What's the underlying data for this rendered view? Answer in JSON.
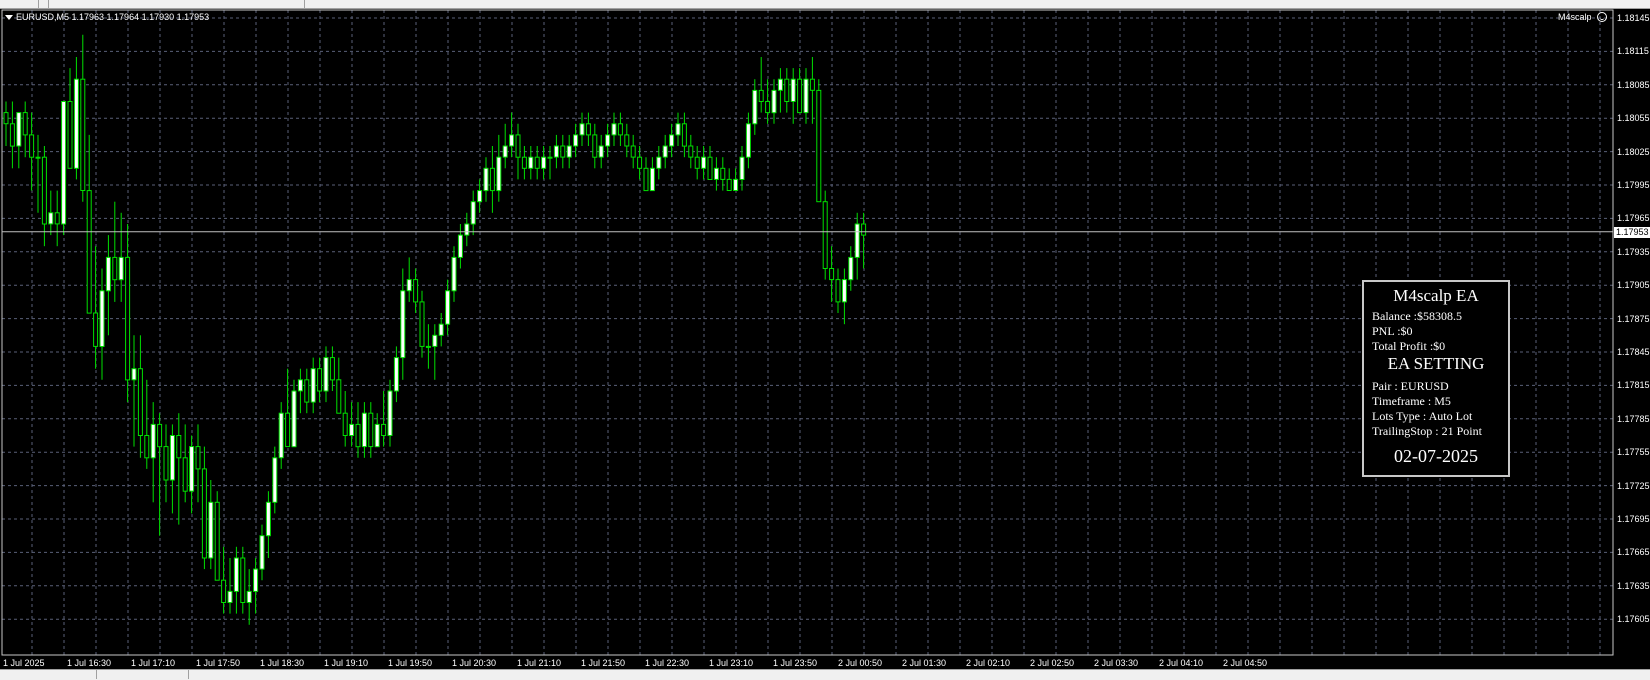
{
  "chart": {
    "symbol_header": "EURUSD,M5  1.17963 1.17964 1.17930 1.17953",
    "ea_name": "M4scalp",
    "current_price": "1.17953",
    "price_axis": [
      "1.18145",
      "1.18115",
      "1.18085",
      "1.18055",
      "1.18025",
      "1.17995",
      "1.17965",
      "1.17935",
      "1.17905",
      "1.17875",
      "1.17845",
      "1.17815",
      "1.17785",
      "1.17755",
      "1.17725",
      "1.17695",
      "1.17665",
      "1.17635",
      "1.17605"
    ],
    "time_axis": [
      "1 Jul 2025",
      "1 Jul 16:30",
      "1 Jul 17:10",
      "1 Jul 17:50",
      "1 Jul 18:30",
      "1 Jul 19:10",
      "1 Jul 19:50",
      "1 Jul 20:30",
      "1 Jul 21:10",
      "1 Jul 21:50",
      "1 Jul 22:30",
      "1 Jul 23:10",
      "1 Jul 23:50",
      "2 Jul 00:50",
      "2 Jul 01:30",
      "2 Jul 02:10",
      "2 Jul 02:50",
      "2 Jul 03:30",
      "2 Jul 04:10",
      "2 Jul 04:50"
    ],
    "colors": {
      "background": "#000000",
      "grid": "#5a6078",
      "bull": "#ffffff",
      "bear": "#000000",
      "wick": "#00e000",
      "text": "#ffffff"
    }
  },
  "ea_panel": {
    "title": "M4scalp EA",
    "balance": "Balance :$58308.5",
    "pnl": "PNL :$0",
    "total_profit": "Total Profit :$0",
    "setting_title": "EA SETTING",
    "pair": "Pair : EURUSD",
    "timeframe": "Timeframe : M5",
    "lots_type": "Lots Type : Auto Lot",
    "trailing_stop": "TrailingStop : 21 Point",
    "date": "02-07-2025"
  },
  "chart_data": {
    "type": "candlestick",
    "ylim": [
      1.1759,
      1.1816
    ],
    "candles": [
      [
        1.1806,
        1.1807,
        1.1803,
        1.1805
      ],
      [
        1.1805,
        1.1807,
        1.1801,
        1.1803
      ],
      [
        1.1803,
        1.1806,
        1.1801,
        1.1806
      ],
      [
        1.1806,
        1.1807,
        1.1802,
        1.1804
      ],
      [
        1.1804,
        1.1806,
        1.1799,
        1.1802
      ],
      [
        1.1802,
        1.1804,
        1.1797,
        1.1802
      ],
      [
        1.1802,
        1.1803,
        1.1794,
        1.1796
      ],
      [
        1.1796,
        1.1799,
        1.1795,
        1.1797
      ],
      [
        1.1797,
        1.1799,
        1.1794,
        1.1796
      ],
      [
        1.1796,
        1.1807,
        1.1795,
        1.1807
      ],
      [
        1.1807,
        1.181,
        1.1804,
        1.1801
      ],
      [
        1.1801,
        1.1811,
        1.18,
        1.1809
      ],
      [
        1.1809,
        1.1813,
        1.1798,
        1.1799
      ],
      [
        1.1799,
        1.1804,
        1.1788,
        1.1788
      ],
      [
        1.1788,
        1.1794,
        1.1783,
        1.1785
      ],
      [
        1.1785,
        1.1792,
        1.1782,
        1.179
      ],
      [
        1.179,
        1.1795,
        1.1786,
        1.1793
      ],
      [
        1.1793,
        1.1798,
        1.1789,
        1.1791
      ],
      [
        1.1791,
        1.1797,
        1.1789,
        1.1793
      ],
      [
        1.1793,
        1.1796,
        1.178,
        1.1782
      ],
      [
        1.1782,
        1.1786,
        1.1776,
        1.1783
      ],
      [
        1.1783,
        1.1786,
        1.1775,
        1.1777
      ],
      [
        1.1777,
        1.1782,
        1.1774,
        1.1775
      ],
      [
        1.1775,
        1.178,
        1.1771,
        1.1778
      ],
      [
        1.1778,
        1.1779,
        1.1768,
        1.1776
      ],
      [
        1.1776,
        1.1778,
        1.1771,
        1.1773
      ],
      [
        1.1773,
        1.1778,
        1.177,
        1.1777
      ],
      [
        1.1777,
        1.1779,
        1.1769,
        1.1775
      ],
      [
        1.1775,
        1.1778,
        1.1771,
        1.1772
      ],
      [
        1.1772,
        1.1777,
        1.177,
        1.1776
      ],
      [
        1.1776,
        1.1778,
        1.1771,
        1.1774
      ],
      [
        1.1774,
        1.1776,
        1.1765,
        1.1766
      ],
      [
        1.1766,
        1.1773,
        1.1765,
        1.1771
      ],
      [
        1.1771,
        1.1772,
        1.1764,
        1.1764
      ],
      [
        1.1764,
        1.1767,
        1.1761,
        1.1762
      ],
      [
        1.1762,
        1.1766,
        1.1761,
        1.1763
      ],
      [
        1.1763,
        1.1767,
        1.1761,
        1.1766
      ],
      [
        1.1766,
        1.1767,
        1.1761,
        1.1762
      ],
      [
        1.1762,
        1.1765,
        1.176,
        1.1763
      ],
      [
        1.1763,
        1.1766,
        1.1761,
        1.1765
      ],
      [
        1.1765,
        1.1769,
        1.1764,
        1.1768
      ],
      [
        1.1768,
        1.1772,
        1.1766,
        1.1771
      ],
      [
        1.1771,
        1.1776,
        1.177,
        1.1775
      ],
      [
        1.1775,
        1.178,
        1.1774,
        1.1779
      ],
      [
        1.1779,
        1.1783,
        1.1776,
        1.1776
      ],
      [
        1.1776,
        1.1782,
        1.1776,
        1.1781
      ],
      [
        1.1781,
        1.1783,
        1.1779,
        1.1782
      ],
      [
        1.1782,
        1.1783,
        1.1779,
        1.178
      ],
      [
        1.178,
        1.1784,
        1.1779,
        1.1783
      ],
      [
        1.1783,
        1.1784,
        1.178,
        1.1781
      ],
      [
        1.1781,
        1.1785,
        1.178,
        1.1784
      ],
      [
        1.1784,
        1.1785,
        1.1781,
        1.1782
      ],
      [
        1.1782,
        1.1784,
        1.1779,
        1.1779
      ],
      [
        1.1779,
        1.1781,
        1.1776,
        1.1777
      ],
      [
        1.1777,
        1.178,
        1.1776,
        1.1778
      ],
      [
        1.1778,
        1.178,
        1.1775,
        1.1776
      ],
      [
        1.1776,
        1.178,
        1.1775,
        1.1779
      ],
      [
        1.1779,
        1.178,
        1.1775,
        1.1776
      ],
      [
        1.1776,
        1.1779,
        1.1776,
        1.1778
      ],
      [
        1.1778,
        1.1781,
        1.1776,
        1.1777
      ],
      [
        1.1777,
        1.1782,
        1.1776,
        1.1781
      ],
      [
        1.1781,
        1.1785,
        1.178,
        1.1784
      ],
      [
        1.1784,
        1.1792,
        1.1782,
        1.179
      ],
      [
        1.179,
        1.1793,
        1.1789,
        1.1791
      ],
      [
        1.1791,
        1.1792,
        1.1788,
        1.1789
      ],
      [
        1.1789,
        1.179,
        1.1784,
        1.1785
      ],
      [
        1.1785,
        1.1787,
        1.1783,
        1.1785
      ],
      [
        1.1785,
        1.1787,
        1.1782,
        1.1786
      ],
      [
        1.1786,
        1.1788,
        1.1785,
        1.1787
      ],
      [
        1.1787,
        1.1791,
        1.1786,
        1.179
      ],
      [
        1.179,
        1.1794,
        1.1789,
        1.1793
      ],
      [
        1.1793,
        1.1796,
        1.1792,
        1.1795
      ],
      [
        1.1795,
        1.1797,
        1.1794,
        1.1796
      ],
      [
        1.1796,
        1.1799,
        1.1795,
        1.1798
      ],
      [
        1.1798,
        1.18,
        1.1797,
        1.1799
      ],
      [
        1.1799,
        1.1802,
        1.1798,
        1.1801
      ],
      [
        1.1801,
        1.1803,
        1.1797,
        1.1799
      ],
      [
        1.1799,
        1.1804,
        1.1798,
        1.1802
      ],
      [
        1.1802,
        1.1805,
        1.1801,
        1.1803
      ],
      [
        1.1803,
        1.1806,
        1.1802,
        1.1804
      ],
      [
        1.1804,
        1.1805,
        1.18,
        1.1802
      ],
      [
        1.1802,
        1.1803,
        1.18,
        1.1801
      ],
      [
        1.1801,
        1.1803,
        1.18,
        1.1802
      ],
      [
        1.1802,
        1.1803,
        1.18,
        1.1801
      ],
      [
        1.1801,
        1.1803,
        1.18,
        1.1802
      ],
      [
        1.1802,
        1.1803,
        1.18,
        1.1802
      ],
      [
        1.1802,
        1.1804,
        1.1801,
        1.1803
      ],
      [
        1.1803,
        1.1804,
        1.1801,
        1.1802
      ],
      [
        1.1802,
        1.1804,
        1.1801,
        1.1803
      ],
      [
        1.1803,
        1.1805,
        1.1802,
        1.1804
      ],
      [
        1.1804,
        1.1806,
        1.1803,
        1.1805
      ],
      [
        1.1805,
        1.1806,
        1.1803,
        1.1804
      ],
      [
        1.1804,
        1.1805,
        1.1801,
        1.1802
      ],
      [
        1.1802,
        1.1804,
        1.1801,
        1.1803
      ],
      [
        1.1803,
        1.1805,
        1.1802,
        1.1804
      ],
      [
        1.1804,
        1.1806,
        1.1803,
        1.1805
      ],
      [
        1.1805,
        1.1806,
        1.1803,
        1.1804
      ],
      [
        1.1804,
        1.1805,
        1.1802,
        1.1803
      ],
      [
        1.1803,
        1.1804,
        1.1801,
        1.1802
      ],
      [
        1.1802,
        1.1803,
        1.18,
        1.1801
      ],
      [
        1.1801,
        1.1802,
        1.1799,
        1.1799
      ],
      [
        1.1799,
        1.1802,
        1.1799,
        1.1801
      ],
      [
        1.1801,
        1.1803,
        1.18,
        1.1802
      ],
      [
        1.1802,
        1.1804,
        1.1801,
        1.1803
      ],
      [
        1.1803,
        1.1805,
        1.1802,
        1.1804
      ],
      [
        1.1804,
        1.1806,
        1.1803,
        1.1805
      ],
      [
        1.1805,
        1.1806,
        1.1802,
        1.1803
      ],
      [
        1.1803,
        1.1804,
        1.1801,
        1.1802
      ],
      [
        1.1802,
        1.1803,
        1.18,
        1.1801
      ],
      [
        1.1801,
        1.1803,
        1.18,
        1.1802
      ],
      [
        1.1802,
        1.1803,
        1.18,
        1.18
      ],
      [
        1.18,
        1.1802,
        1.1799,
        1.1801
      ],
      [
        1.1801,
        1.1802,
        1.1799,
        1.18
      ],
      [
        1.18,
        1.1801,
        1.1799,
        1.1799
      ],
      [
        1.1799,
        1.1801,
        1.1799,
        1.18
      ],
      [
        1.18,
        1.1803,
        1.1799,
        1.1802
      ],
      [
        1.1802,
        1.1806,
        1.1801,
        1.1805
      ],
      [
        1.1805,
        1.1809,
        1.1804,
        1.1808
      ],
      [
        1.1808,
        1.1811,
        1.1806,
        1.1807
      ],
      [
        1.1807,
        1.1809,
        1.1805,
        1.1806
      ],
      [
        1.1806,
        1.1809,
        1.1805,
        1.1808
      ],
      [
        1.1808,
        1.181,
        1.1806,
        1.1809
      ],
      [
        1.1809,
        1.181,
        1.1806,
        1.1807
      ],
      [
        1.1807,
        1.181,
        1.1805,
        1.1809
      ],
      [
        1.1809,
        1.181,
        1.1806,
        1.1806
      ],
      [
        1.1806,
        1.181,
        1.1805,
        1.1809
      ],
      [
        1.1809,
        1.1811,
        1.1805,
        1.1808
      ],
      [
        1.1808,
        1.1809,
        1.1798,
        1.1798
      ],
      [
        1.1798,
        1.1799,
        1.1791,
        1.1792
      ],
      [
        1.1792,
        1.1794,
        1.1789,
        1.1791
      ],
      [
        1.1791,
        1.1792,
        1.1788,
        1.1789
      ],
      [
        1.1789,
        1.1792,
        1.1787,
        1.1791
      ],
      [
        1.1791,
        1.1794,
        1.179,
        1.1793
      ],
      [
        1.1793,
        1.1797,
        1.1791,
        1.1796
      ],
      [
        1.1796,
        1.1797,
        1.1792,
        1.1795
      ]
    ]
  }
}
